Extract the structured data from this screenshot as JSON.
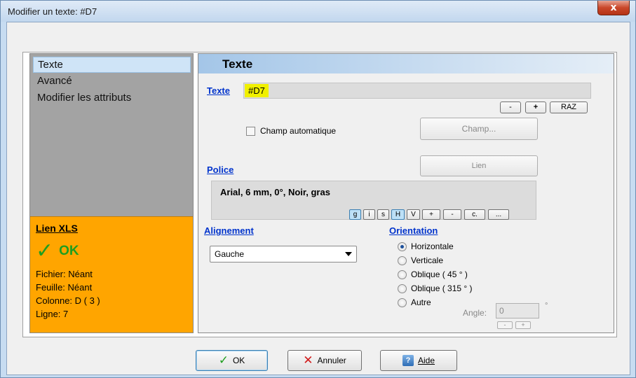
{
  "window": {
    "title": "Modifier un texte: #D7",
    "close_glyph": "x"
  },
  "nav": {
    "items": [
      "Texte",
      "Avancé",
      "Modifier les attributs"
    ],
    "selected": 0
  },
  "xls": {
    "title": "Lien XLS",
    "status": "OK",
    "fichier": "Fichier: Néant",
    "feuille": "Feuille: Néant",
    "colonne": "Colonne: D ( 3 )",
    "ligne": "Ligne: 7"
  },
  "panel": {
    "header": "Texte",
    "text_link": "Texte",
    "text_value": "#D7",
    "btn_minus": "-",
    "btn_plus": "+",
    "btn_raz": "RAZ",
    "auto_field_label": "Champ automatique",
    "champ_button": "Champ...",
    "police_link": "Police",
    "lien_button": "Lien",
    "police_value": "Arial, 6 mm, 0°, Noir, gras",
    "font_buttons": [
      "g",
      "i",
      "s",
      "H",
      "V",
      "+",
      "-",
      "c.",
      "..."
    ],
    "active_font_buttons": [
      "g",
      "H"
    ],
    "alignment_link": "Alignement",
    "alignment_value": "Gauche",
    "orientation_link": "Orientation",
    "orientation_options": [
      "Horizontale",
      "Verticale",
      "Oblique ( 45 ° )",
      "Oblique ( 315 ° )",
      "Autre"
    ],
    "orientation_selected": 0,
    "angle_label": "Angle:",
    "angle_value": "0",
    "angle_unit": "°",
    "angle_minus": "-",
    "angle_plus": "+"
  },
  "footer": {
    "ok": "OK",
    "cancel": "Annuler",
    "help": "Aide"
  },
  "colors": {
    "xls_bg": "#ffa500",
    "ok_green": "#1f9e1f",
    "link_blue": "#0033cc",
    "highlight": "#f0f000"
  },
  "icons": {
    "ok": "check-icon",
    "cancel": "cross-icon",
    "help": "help-icon"
  }
}
